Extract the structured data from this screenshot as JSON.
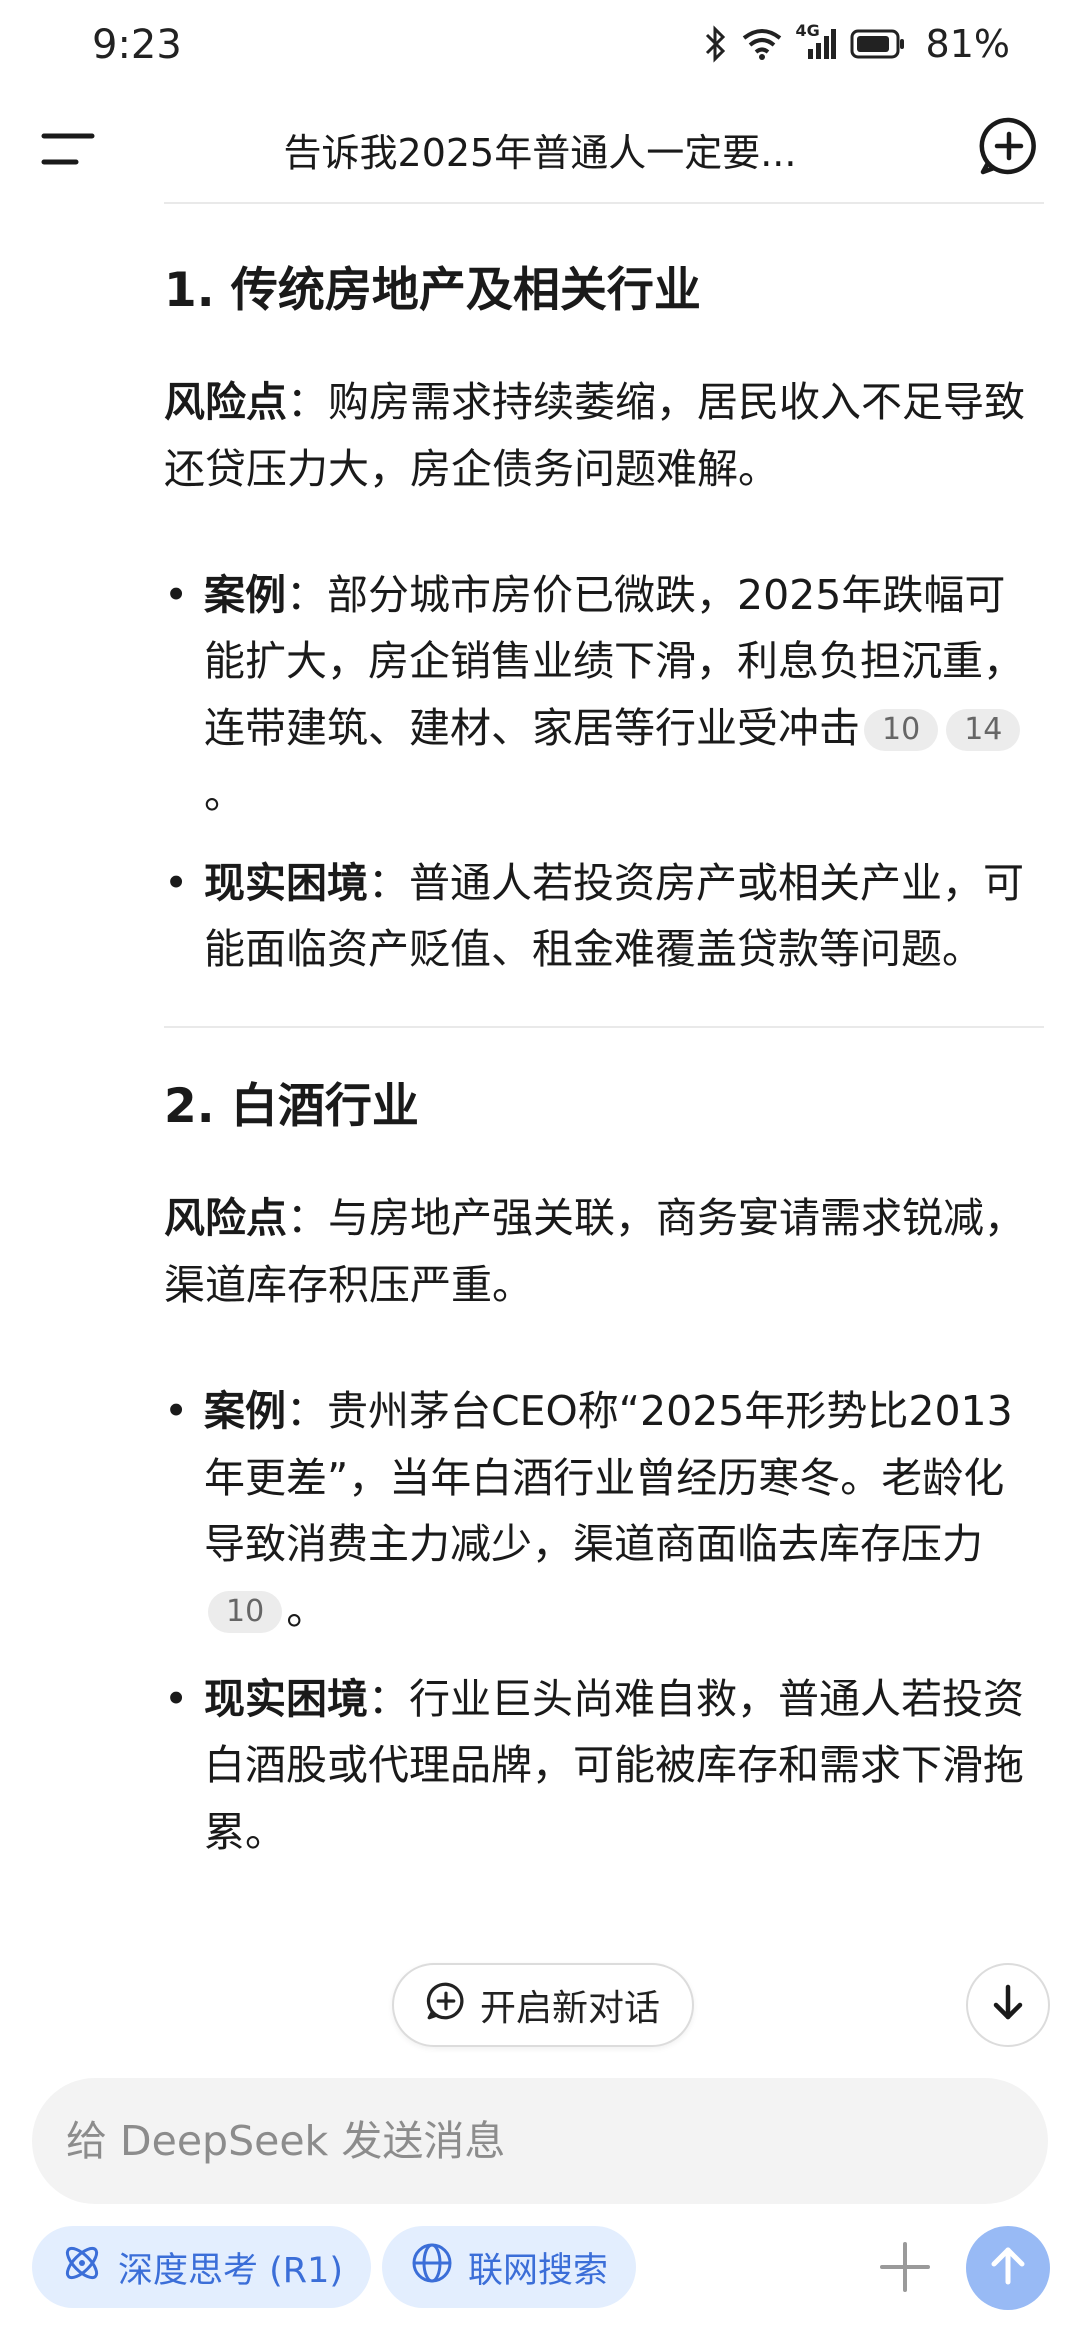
{
  "status_bar": {
    "time": "9:23",
    "network": "4G",
    "battery": "81%"
  },
  "header": {
    "title": "告诉我2025年普通人一定要..."
  },
  "sections": [
    {
      "title": "1. 传统房地产及相关行业",
      "risk_label": "风险点",
      "risk_text": "：购房需求持续萎缩，居民收入不足导致还贷压力大，房企债务问题难解。",
      "bullets": [
        {
          "label": "案例",
          "text": "：部分城市房价已微跌，2025年跌幅可能扩大，房企销售业绩下滑，利息负担沉重，连带建筑、建材、家居等行业受冲击",
          "cites": [
            "10",
            "14"
          ],
          "end": "。"
        },
        {
          "label": "现实困境",
          "text": "：普通人若投资房产或相关产业，可能面临资产贬值、租金难覆盖贷款等问题。",
          "cites": [],
          "end": ""
        }
      ]
    },
    {
      "title": "2. 白酒行业",
      "risk_label": "风险点",
      "risk_text": "：与房地产强关联，商务宴请需求锐减，渠道库存积压严重。",
      "bullets": [
        {
          "label": "案例",
          "text": "：贵州茅台CEO称“2025年形势比2013年更差”，当年白酒行业曾经历寒冬。老龄化导致消费主力减少，渠道商面临去库存压力",
          "cites": [
            "10"
          ],
          "end": "。"
        },
        {
          "label": "现实困境",
          "text": "：行业巨头尚难自救，普通人若投资白酒股或代理品牌，可能被库存和需求下滑拖累。",
          "cites": [],
          "end": ""
        }
      ]
    }
  ],
  "floating": {
    "new_chat_label": "开启新对话"
  },
  "input": {
    "placeholder": "给 DeepSeek 发送消息"
  },
  "toolbar": {
    "deep_think_label": "深度思考 (R1)",
    "web_search_label": "联网搜索"
  },
  "colors": {
    "accent": "#3b6ed8",
    "chip_bg": "#e3eefe",
    "send_bg": "#98baf5"
  },
  "icons": {
    "menu": "menu-icon",
    "new_chat": "new-chat-icon",
    "scroll_down": "arrow-down-icon",
    "deep_think": "atom-icon",
    "web_search": "globe-icon",
    "plus": "plus-icon",
    "send": "arrow-up-icon"
  }
}
